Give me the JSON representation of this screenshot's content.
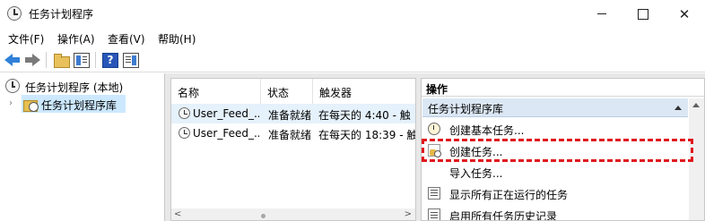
{
  "window": {
    "title": "任务计划程序",
    "close_glyph": "✕"
  },
  "menu": {
    "items": [
      "文件(F)",
      "操作(A)",
      "查看(V)",
      "帮助(H)"
    ]
  },
  "toolbar": {
    "help_glyph": "?"
  },
  "tree": {
    "root_label": "任务计划程序 (本地)",
    "child_label": "任务计划程序库",
    "chevron": "›"
  },
  "list": {
    "columns": [
      "名称",
      "状态",
      "触发器"
    ],
    "rows": [
      {
        "name": "User_Feed_...",
        "status": "准备就绪",
        "trigger": "在每天的 4:40 - 触"
      },
      {
        "name": "User_Feed_...",
        "status": "准备就绪",
        "trigger": "在每天的 18:39 - 触"
      }
    ],
    "scroll_left": "<",
    "scroll_right": ">"
  },
  "actions": {
    "header": "操作",
    "section_title": "任务计划程序库",
    "items": [
      {
        "label": "创建基本任务...",
        "icon": "basic-task-icon"
      },
      {
        "label": "创建任务...",
        "icon": "create-task-icon"
      },
      {
        "label": "导入任务...",
        "icon": "import-icon"
      },
      {
        "label": "显示所有正在运行的任务",
        "icon": "running-tasks-icon"
      },
      {
        "label": "启用所有任务历史记录",
        "icon": "history-icon"
      }
    ]
  },
  "colors": {
    "highlight": "#e0181c",
    "selection": "#cce8ff",
    "section_bg": "#dbe7f4"
  }
}
